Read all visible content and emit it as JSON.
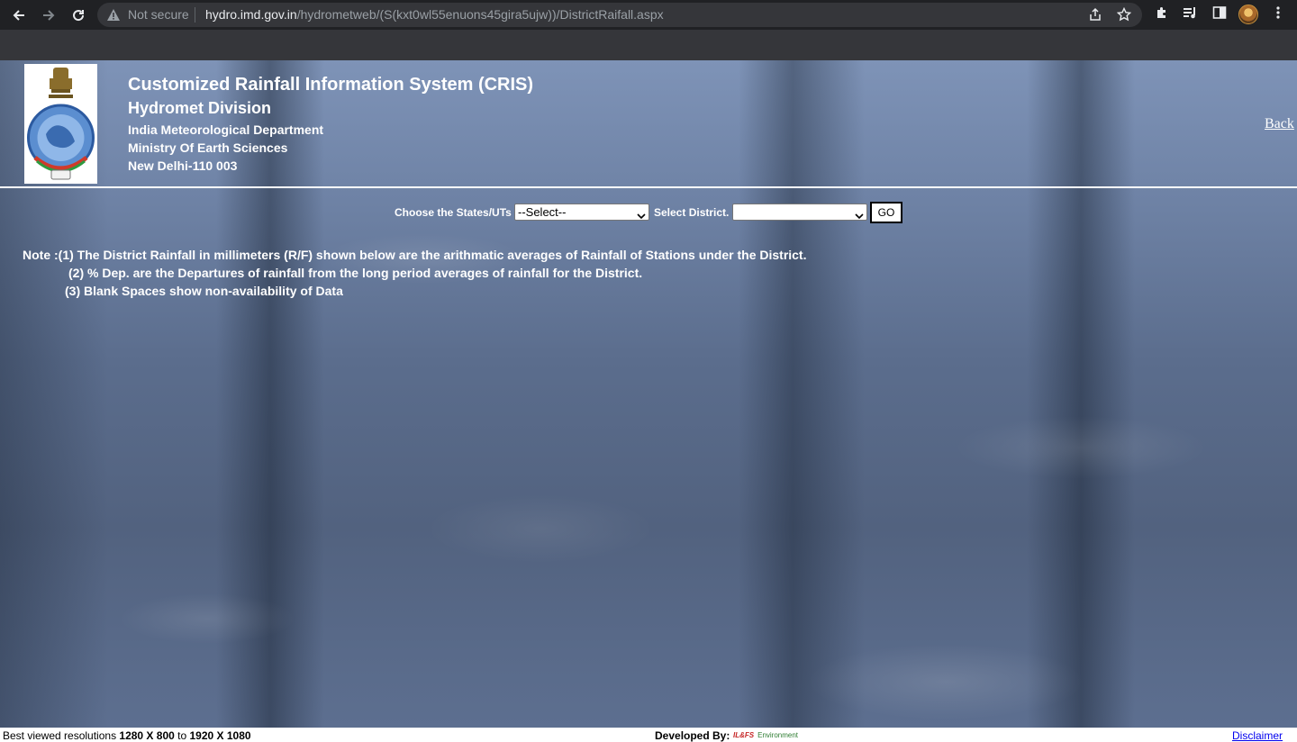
{
  "browser": {
    "security_label": "Not secure",
    "url_host": "hydro.imd.gov.in",
    "url_path": "/hydrometweb/(S(kxt0wl55enuons45gira5ujw))/DistrictRaifall.aspx"
  },
  "header": {
    "title": "Customized Rainfall Information System (CRIS)",
    "division": "Hydromet Division",
    "org_lines": [
      "India Meteorological Department",
      "Ministry Of Earth Sciences",
      "New Delhi-110 003"
    ],
    "back_link": "Back"
  },
  "filters": {
    "state_label": "Choose the States/UTs",
    "state_selected": "--Select--",
    "district_label": "Select District.",
    "district_selected": "",
    "go_label": "GO"
  },
  "notes": [
    "Note :(1) The District Rainfall in millimeters (R/F) shown below are the arithmatic averages of Rainfall of Stations under the District.",
    "(2) % Dep. are the Departures of rainfall from the long period averages of rainfall for the District.",
    "(3) Blank Spaces show non-availability of Data"
  ],
  "footer": {
    "best_viewed_prefix": "Best viewed resolutions ",
    "res_1": "1280 X 800",
    "to": " to ",
    "res_2": "1920 X 1080",
    "developed_by": "Developed By:",
    "dev_logo_main": "IL&FS",
    "dev_logo_sub": "Environment",
    "disclaimer": "Disclaimer"
  },
  "colors": {
    "chrome_dark": "#202124",
    "chrome_tabstrip": "#35363a",
    "page_text": "#ffffff",
    "link_blue": "#0000ee"
  },
  "icons": [
    "back-arrow-icon",
    "forward-arrow-icon",
    "reload-icon",
    "warning-icon",
    "share-icon",
    "star-icon",
    "puzzle-icon",
    "media-icon",
    "side-panel-icon",
    "kebab-menu-icon",
    "imd-emblem-logo"
  ]
}
